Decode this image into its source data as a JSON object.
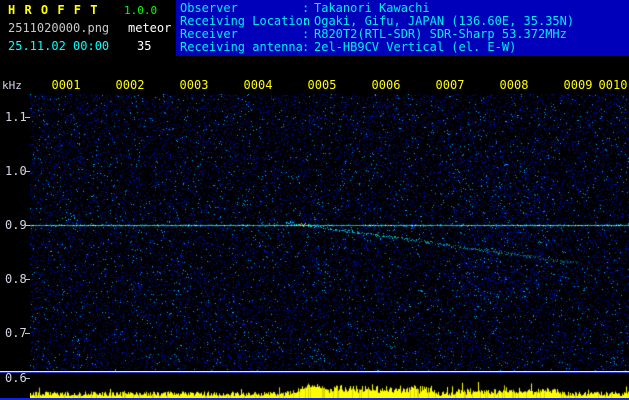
{
  "header": {
    "title": "H R O F F T",
    "version": "1.0.0",
    "filename": "2511020000.png",
    "mode": "meteor",
    "datetime": "25.11.02 00:00",
    "count": "35",
    "separator": ":",
    "info_rows": [
      {
        "label": "Observer",
        "value": "Takanori Kawachi"
      },
      {
        "label": "Receiving Location",
        "value": "Ogaki, Gifu, JAPAN (136.60E, 35.35N)"
      },
      {
        "label": "Receiver",
        "value": "R820T2(RTL-SDR) SDR-Sharp 53.372MHz"
      },
      {
        "label": "Receiving antenna",
        "value": "2el-HB9CV Vertical (el. E-W)"
      }
    ]
  },
  "spectrogram": {
    "y_unit": "kHz",
    "freq_labels": [
      "1.1",
      "1.0",
      "0.9",
      "0.8",
      "0.7",
      "0.6"
    ],
    "time_labels": [
      "0001",
      "0002",
      "0003",
      "0004",
      "0005",
      "0006",
      "0007",
      "0008",
      "0009",
      "0010"
    ],
    "carrier_khz": "0.9",
    "colors": {
      "header_bg": "#0000bb",
      "info_text": "#00eeee",
      "title": "#ffff00",
      "version": "#00ff00",
      "time_label": "#ffff00",
      "freq_label": "#d4d4e4",
      "carrier": "#00ffff",
      "noise": "#2233ee",
      "trail": "#00e0ff",
      "trail_head": "#ff4000",
      "level_bar": "#ffff00",
      "baseline": "#1120ee"
    }
  }
}
